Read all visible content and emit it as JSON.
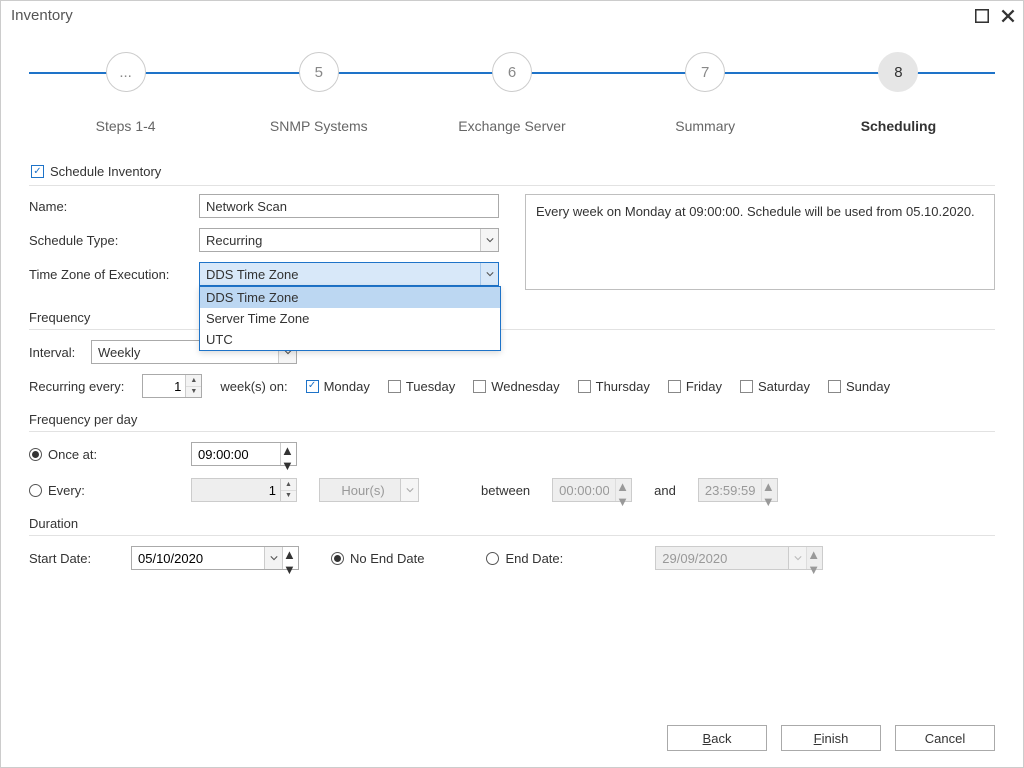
{
  "window": {
    "title": "Inventory"
  },
  "stepper": {
    "steps": [
      {
        "num": "...",
        "label": "Steps 1-4"
      },
      {
        "num": "5",
        "label": "SNMP Systems"
      },
      {
        "num": "6",
        "label": "Exchange Server"
      },
      {
        "num": "7",
        "label": "Summary"
      },
      {
        "num": "8",
        "label": "Scheduling"
      }
    ],
    "active_index": 4
  },
  "schedule_checkbox": {
    "label": "Schedule Inventory",
    "checked": true
  },
  "form": {
    "name_label": "Name:",
    "name_value": "Network Scan",
    "type_label": "Schedule Type:",
    "type_value": "Recurring",
    "tz_label": "Time Zone of Execution:",
    "tz_value": "DDS Time Zone",
    "tz_options": [
      "DDS Time Zone",
      "Server Time Zone",
      "UTC"
    ],
    "description": "Every week on Monday at 09:00:00. Schedule will be used from 05.10.2020."
  },
  "frequency": {
    "header": "Frequency",
    "interval_label": "Interval:",
    "interval_value": "Weekly",
    "recur_label": "Recurring every:",
    "recur_value": "1",
    "recur_unit": "week(s) on:",
    "days": [
      {
        "label": "Monday",
        "checked": true
      },
      {
        "label": "Tuesday",
        "checked": false
      },
      {
        "label": "Wednesday",
        "checked": false
      },
      {
        "label": "Thursday",
        "checked": false
      },
      {
        "label": "Friday",
        "checked": false
      },
      {
        "label": "Saturday",
        "checked": false
      },
      {
        "label": "Sunday",
        "checked": false
      }
    ]
  },
  "perday": {
    "header": "Frequency per day",
    "once_label": "Once at:",
    "once_value": "09:00:00",
    "every_label": "Every:",
    "every_value": "1",
    "every_unit": "Hour(s)",
    "between_label": "between",
    "between_from": "00:00:00",
    "and_label": "and",
    "between_to": "23:59:59",
    "mode": "once"
  },
  "duration": {
    "header": "Duration",
    "start_label": "Start Date:",
    "start_value": "05/10/2020",
    "noend_label": "No End Date",
    "end_label": "End Date:",
    "end_value": "29/09/2020",
    "mode": "noend"
  },
  "buttons": {
    "back": "Back",
    "finish": "Finish",
    "cancel": "Cancel"
  }
}
